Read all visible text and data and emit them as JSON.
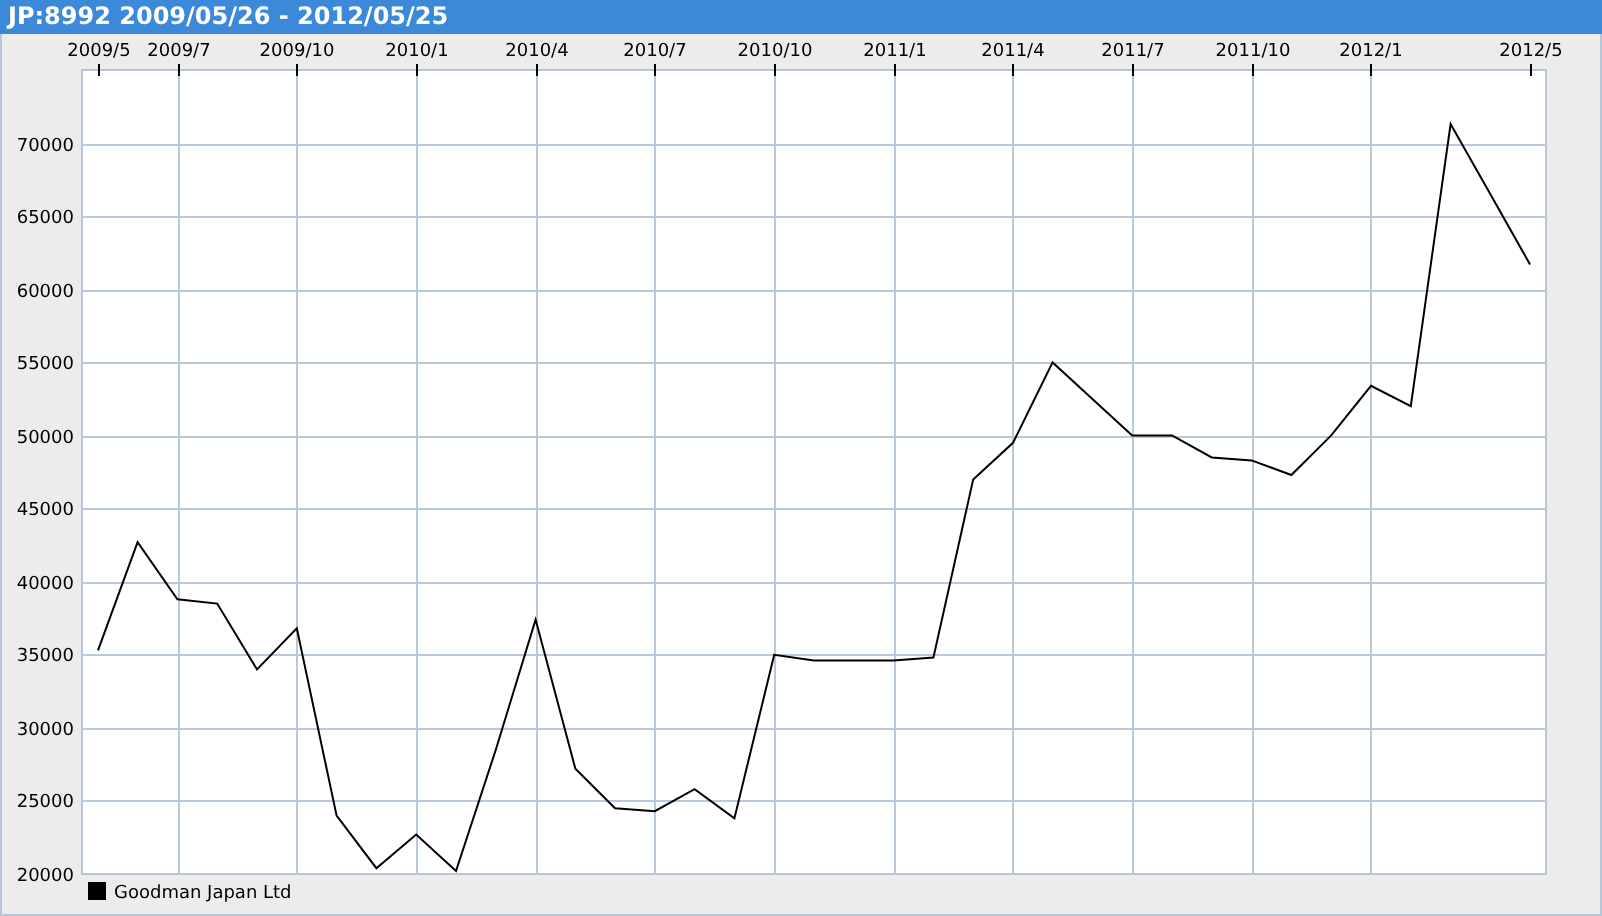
{
  "window": {
    "title": "JP:8992 2009/05/26 - 2012/05/25"
  },
  "chart": {
    "chart_data": {
      "type": "line",
      "categories": [
        "2009/5",
        null,
        "2009/7",
        null,
        null,
        "2009/10",
        null,
        null,
        "2010/1",
        null,
        null,
        "2010/4",
        null,
        null,
        "2010/7",
        null,
        null,
        "2010/10",
        null,
        null,
        "2011/1",
        null,
        null,
        "2011/4",
        null,
        null,
        "2011/7",
        null,
        null,
        "2011/10",
        null,
        null,
        "2012/1",
        null,
        null,
        null,
        "2012/5"
      ],
      "series": [
        {
          "name": "Goodman Japan Ltd",
          "color": "#000000",
          "values": [
            35300,
            42700,
            38800,
            38500,
            34000,
            36800,
            24000,
            20400,
            22700,
            20200,
            28500,
            37400,
            27200,
            24500,
            24300,
            25800,
            23800,
            35000,
            34600,
            34600,
            34600,
            34800,
            47000,
            49500,
            55000,
            52500,
            50000,
            50000,
            48500,
            48300,
            47300,
            50000,
            53400,
            52000,
            71300,
            66500,
            61700
          ]
        }
      ],
      "ylim": [
        20000,
        75000
      ],
      "grid": true,
      "yticks": [
        20000,
        25000,
        30000,
        35000,
        40000,
        45000,
        50000,
        55000,
        60000,
        65000,
        70000
      ]
    }
  }
}
